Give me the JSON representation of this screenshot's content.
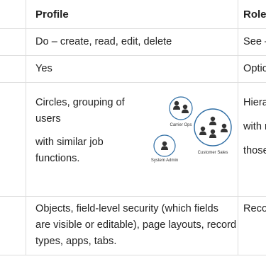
{
  "table": {
    "headers": {
      "profile": "Profile",
      "role": "Role"
    },
    "rows": [
      {
        "profile": "Do – create, read, edit, delete",
        "role": "See –"
      },
      {
        "profile": "Yes",
        "role": "Optio"
      },
      {
        "profile_lines": [
          "Circles, grouping of",
          "users",
          "with similar job",
          "functions."
        ],
        "role_lines": [
          "Hiera",
          "with r",
          "those"
        ]
      },
      {
        "profile_lines": [
          "Objects, field-level security (which fields",
          "are visible or editable), page layouts, record",
          "types, apps, tabs."
        ],
        "role": "Reco"
      }
    ]
  },
  "diagram": {
    "groups": [
      {
        "label": "Carrier Ops"
      },
      {
        "label": "Customer Sales"
      },
      {
        "label": "System Admin"
      }
    ],
    "colors": {
      "ring": "#2e6da4",
      "person": "#333333"
    }
  }
}
